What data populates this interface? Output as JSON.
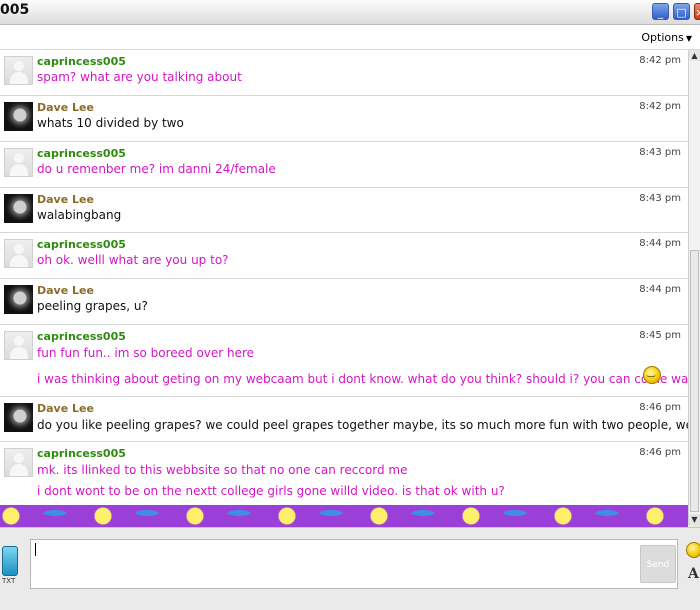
{
  "window": {
    "title": "005",
    "minimize_glyph": "_",
    "maximize_glyph": "□",
    "close_glyph": "×"
  },
  "toolbar": {
    "options_label": "Options"
  },
  "messages": [
    {
      "sender": "caprincess005",
      "time": "8:42 pm",
      "lines": [
        "spam? what are you talking about"
      ]
    },
    {
      "sender": "Dave Lee",
      "time": "8:42 pm",
      "lines": [
        "whats 10 divided by two"
      ]
    },
    {
      "sender": "caprincess005",
      "time": "8:43 pm",
      "lines": [
        "do u remenber me? im danni 24/female"
      ]
    },
    {
      "sender": "Dave Lee",
      "time": "8:43 pm",
      "lines": [
        "walabingbang"
      ]
    },
    {
      "sender": "caprincess005",
      "time": "8:44 pm",
      "lines": [
        "oh ok. welll what are you up to?"
      ]
    },
    {
      "sender": "Dave Lee",
      "time": "8:44 pm",
      "lines": [
        "peeling grapes, u?"
      ]
    },
    {
      "sender": "caprincess005",
      "time": "8:45 pm",
      "lines": [
        "fun fun fun.. im so boreed over here",
        "i was thinking about geting on my webcaam but i dont know. what do you think? should i? you can come watch"
      ]
    },
    {
      "sender": "Dave Lee",
      "time": "8:46 pm",
      "lines": [
        "do you like peeling grapes? we could peel grapes together maybe, its so much more fun with two people, we could race"
      ]
    },
    {
      "sender": "caprincess005",
      "time": "8:46 pm",
      "lines": [
        "mk. its llinked to this webbsite so that no one can reccord me",
        "i dont wont to be on the nextt college girls gone willd video. is that ok with u?"
      ]
    }
  ],
  "input": {
    "value": "",
    "send_label": "Send",
    "txt_label": "TXT",
    "font_glyph": "A"
  },
  "icons": [
    "blank-avatar-icon",
    "photo-avatar-icon",
    "smiley-icon",
    "sms-phone-icon",
    "emoticon-icon",
    "font-icon",
    "scroll-up-icon",
    "scroll-down-icon"
  ],
  "colors": {
    "caprincess_text": "#d316c5",
    "caprincess_name": "#2e8b10",
    "dave_name": "#8a6c2b",
    "pattern_bg": "#9a3fd8"
  }
}
